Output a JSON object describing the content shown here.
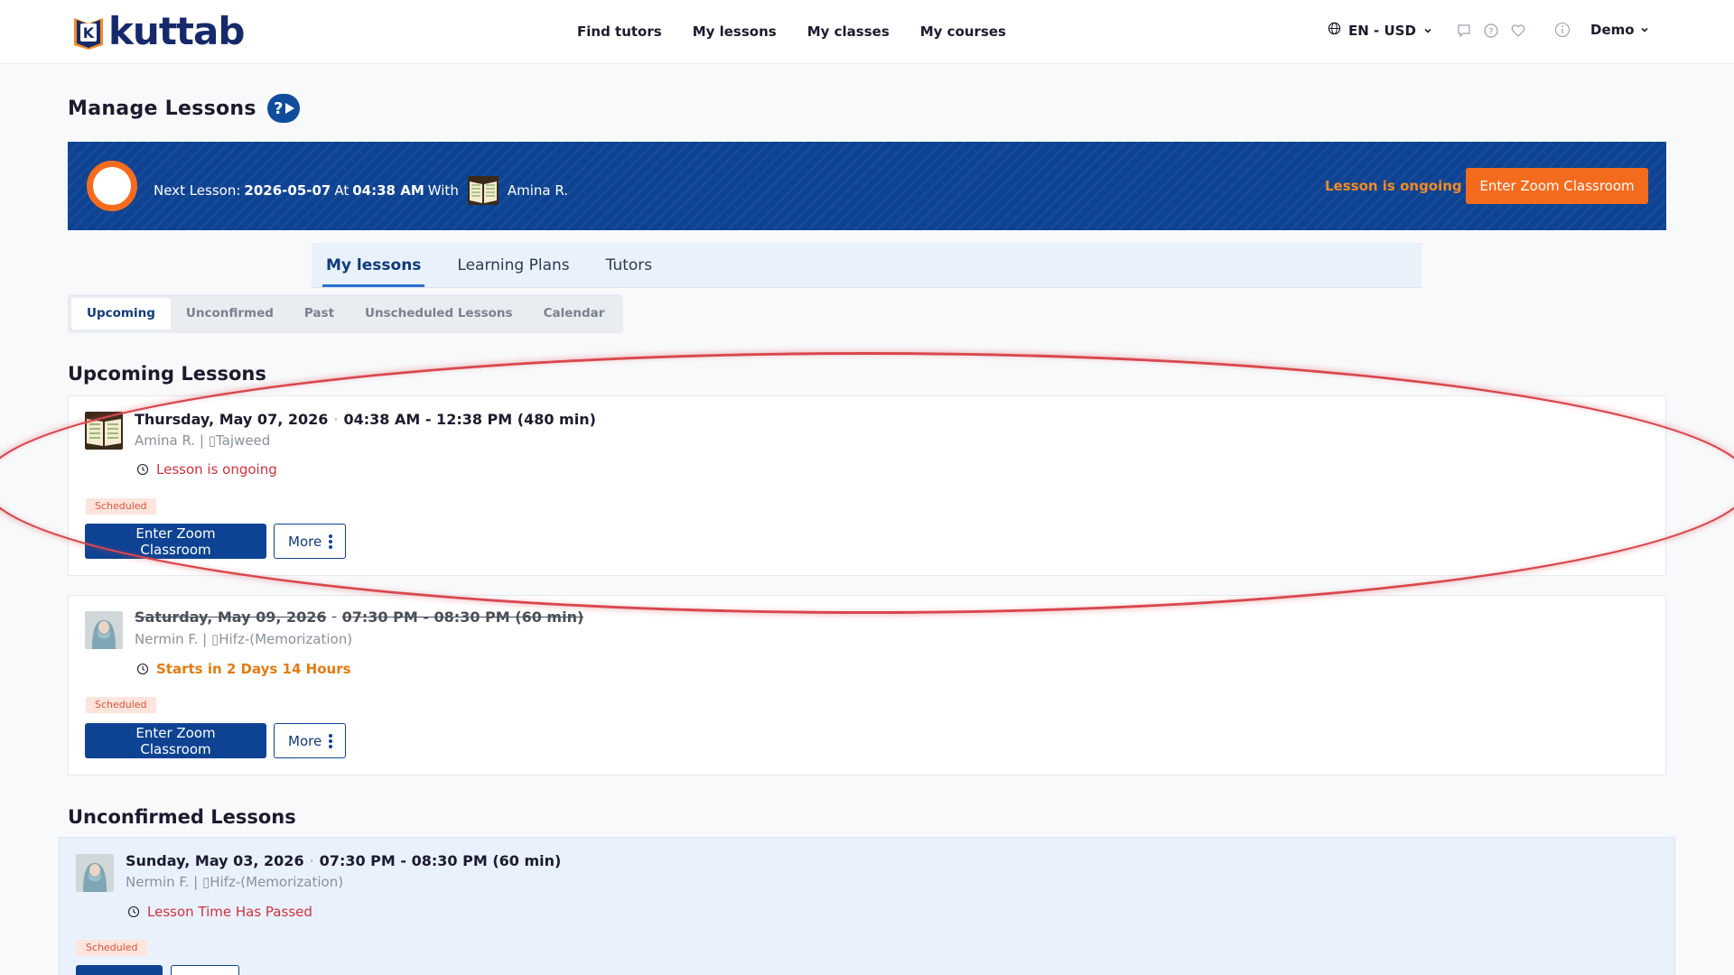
{
  "header": {
    "logo_text": "kuttab",
    "logo_badge": "K",
    "nav": [
      "Find tutors",
      "My lessons",
      "My classes",
      "My courses"
    ],
    "language": "EN - USD",
    "user": "Demo"
  },
  "page": {
    "title": "Manage Lessons"
  },
  "banner": {
    "prefix": "Next Lesson:",
    "date": "2026-05-07",
    "at": "At",
    "time": "04:38 AM",
    "with": "With",
    "tutor": "Amina R.",
    "status": "Lesson is ongoing",
    "button": "Enter Zoom Classroom"
  },
  "main_tabs": [
    "My lessons",
    "Learning Plans",
    "Tutors"
  ],
  "sub_tabs": [
    "Upcoming",
    "Unconfirmed",
    "Past",
    "Unscheduled Lessons",
    "Calendar"
  ],
  "upcoming": {
    "title": "Upcoming Lessons",
    "lessons": [
      {
        "date": "Thursday, May 07, 2026",
        "time": "04:38 AM - 12:38 PM (480 min)",
        "detail": "Amina R. | ▯Tajweed",
        "status": "Lesson is ongoing",
        "badge": "Scheduled",
        "enter": "Enter Zoom Classroom",
        "more": "More"
      },
      {
        "date": "Saturday, May 09, 2026",
        "time": "07:30 PM - 08:30 PM (60 min)",
        "detail": "Nermin F. | ▯Hifz-(Memorization)",
        "status": "Starts in 2 Days 14 Hours",
        "badge": "Scheduled",
        "enter": "Enter Zoom Classroom",
        "more": "More"
      }
    ]
  },
  "unconfirmed": {
    "title": "Unconfirmed Lessons",
    "lessons": [
      {
        "date": "Sunday, May 03, 2026",
        "time": "07:30 PM - 08:30 PM (60 min)",
        "detail": "Nermin F. | ▯Hifz-(Memorization)",
        "status": "Lesson Time Has Passed",
        "badge": "Scheduled"
      }
    ]
  },
  "colors": {
    "brand_blue": "#0e4393",
    "accent_orange": "#f56b1d",
    "status_red": "#d2313d",
    "status_orange": "#e37b12"
  },
  "icons": [
    "globe-icon",
    "chat-icon",
    "help-icon",
    "heart-icon",
    "info-icon",
    "chevron-down-icon",
    "clock-icon",
    "kebab-icon",
    "play-help-icon"
  ]
}
